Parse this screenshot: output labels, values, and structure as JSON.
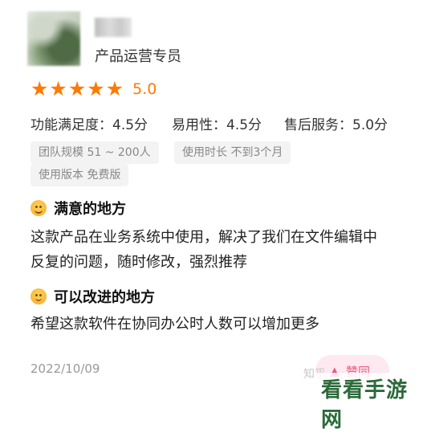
{
  "reviewer": {
    "role": "产品运营专员"
  },
  "rating": {
    "stars": 5,
    "score": "5.0"
  },
  "scores": [
    {
      "label": "功能满足度：4.5分"
    },
    {
      "label": "易用性：4.5分"
    },
    {
      "label": "售后服务：5.0分"
    }
  ],
  "tags": [
    "团队规模 51 ~ 200人",
    "使用时长 不到3个月",
    "使用版本 免费版"
  ],
  "satisfied": {
    "heading": "满意的地方",
    "text_line1": "这款产品在业务系统中使用，解决了我们在文件编辑中",
    "text_line2": "反复的问题，随时修改，强烈推荐"
  },
  "improve": {
    "heading": "可以改进的地方",
    "text": "希望这款软件在协同办公时人数可以增加更多"
  },
  "date": "2022/10/09",
  "like_button": {
    "icon": "thumb-up-icon",
    "label": "赞同"
  },
  "watermark": {
    "zhihu": "知乎",
    "site": "看看手游网"
  },
  "colors": {
    "accent": "#ff7a00",
    "like": "#e85a7d",
    "tag_bg": "#f3f3f3"
  }
}
